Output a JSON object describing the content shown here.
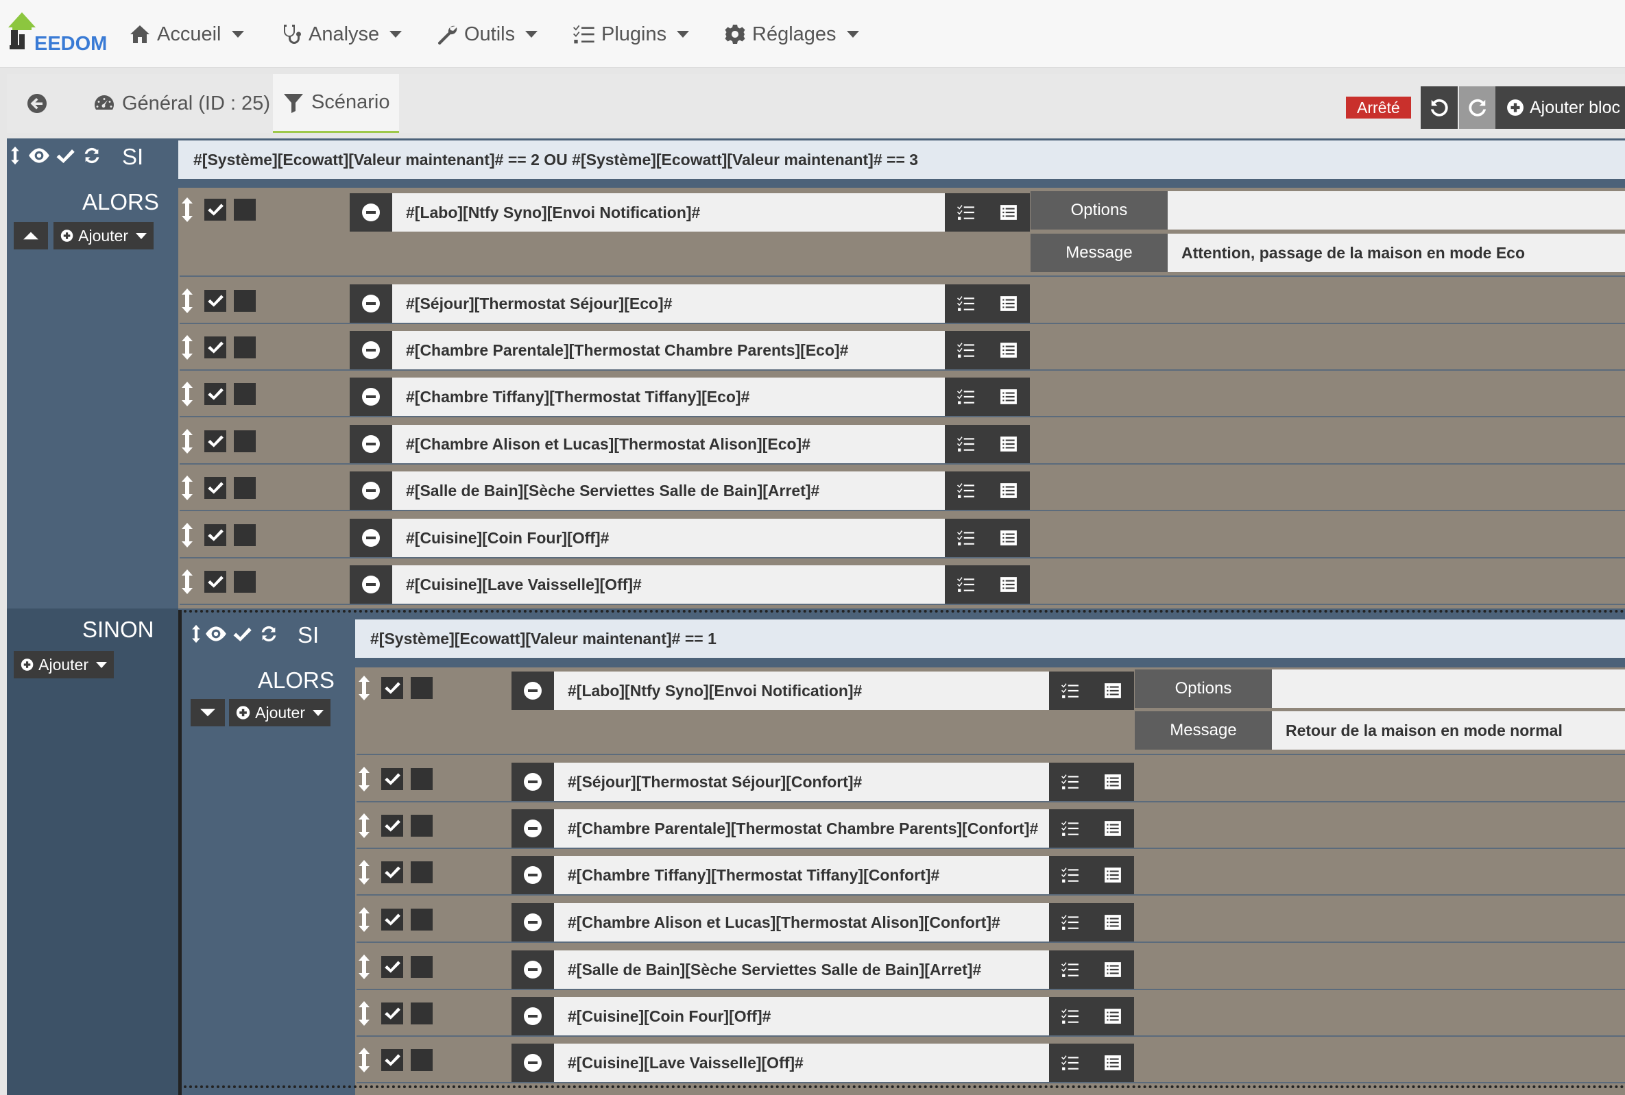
{
  "nav": {
    "logo_text": "EEDOM",
    "items": [
      {
        "label": "Accueil",
        "icon": "home-icon"
      },
      {
        "label": "Analyse",
        "icon": "stethoscope-icon"
      },
      {
        "label": "Outils",
        "icon": "wrench-icon"
      },
      {
        "label": "Plugins",
        "icon": "tasks-icon"
      },
      {
        "label": "Réglages",
        "icon": "cog-icon"
      }
    ]
  },
  "tabs": {
    "general": "Général (ID : 25)",
    "scenario": "Scénario"
  },
  "toolbar": {
    "state": "Arrêté",
    "add_block": "Ajouter bloc"
  },
  "block1": {
    "si": "SI",
    "alors": "ALORS",
    "sinon": "SINON",
    "add": "Ajouter",
    "condition": "#[Système][Ecowatt][Valeur maintenant]# == 2 OU #[Système][Ecowatt][Valeur maintenant]# == 3",
    "options_label": "Options",
    "message_label": "Message",
    "message_value": "Attention, passage de la maison en mode Eco",
    "actions": [
      "#[Labo][Ntfy Syno][Envoi Notification]#",
      "#[Séjour][Thermostat Séjour][Eco]#",
      "#[Chambre Parentale][Thermostat Chambre Parents][Eco]#",
      "#[Chambre Tiffany][Thermostat Tiffany][Eco]#",
      "#[Chambre Alison et Lucas][Thermostat Alison][Eco]#",
      "#[Salle de Bain][Sèche Serviettes Salle de Bain][Arret]#",
      "#[Cuisine][Coin Four][Off]#",
      "#[Cuisine][Lave Vaisselle][Off]#"
    ]
  },
  "block2": {
    "si": "SI",
    "alors": "ALORS",
    "add": "Ajouter",
    "condition": "#[Système][Ecowatt][Valeur maintenant]# == 1",
    "options_label": "Options",
    "message_label": "Message",
    "message_value": "Retour de la maison en mode normal",
    "actions": [
      "#[Labo][Ntfy Syno][Envoi Notification]#",
      "#[Séjour][Thermostat Séjour][Confort]#",
      "#[Chambre Parentale][Thermostat Chambre Parents][Confort]#",
      "#[Chambre Tiffany][Thermostat Tiffany][Confort]#",
      "#[Chambre Alison et Lucas][Thermostat Alison][Confort]#",
      "#[Salle de Bain][Sèche Serviettes Salle de Bain][Arret]#",
      "#[Cuisine][Coin Four][Off]#",
      "#[Cuisine][Lave Vaisselle][Off]#"
    ]
  }
}
